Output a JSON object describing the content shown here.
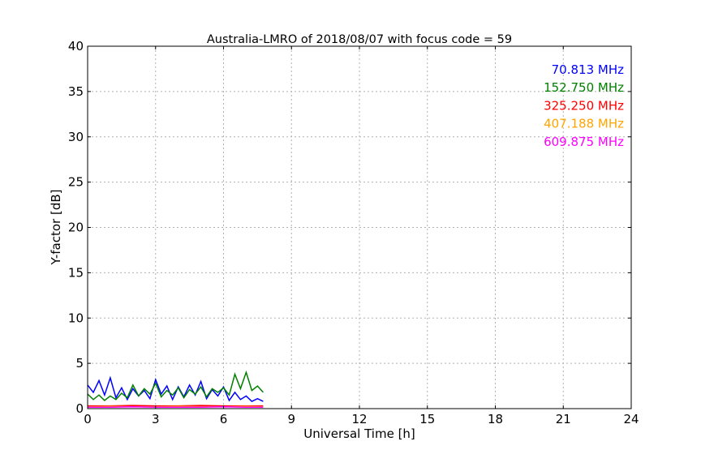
{
  "chart_data": {
    "type": "line",
    "title": "Australia-LMRO of 2018/08/07 with focus code = 59",
    "xlabel": "Universal Time [h]",
    "ylabel": "Y-factor [dB]",
    "xlim": [
      0,
      24
    ],
    "ylim": [
      0,
      40
    ],
    "xticks": [
      0,
      3,
      6,
      9,
      12,
      15,
      18,
      21,
      24
    ],
    "yticks": [
      0,
      5,
      10,
      15,
      20,
      25,
      30,
      35,
      40
    ],
    "grid": true,
    "legend_placement": "top-right",
    "series": [
      {
        "name": "70.813 MHz",
        "color": "#0000ff",
        "x": [
          0,
          0.25,
          0.5,
          0.75,
          1,
          1.25,
          1.5,
          1.75,
          2,
          2.25,
          2.5,
          2.75,
          3,
          3.25,
          3.5,
          3.75,
          4,
          4.25,
          4.5,
          4.75,
          5,
          5.25,
          5.5,
          5.75,
          6,
          6.25,
          6.5,
          6.75,
          7,
          7.25,
          7.5,
          7.75
        ],
        "values": [
          2.6,
          1.8,
          3.1,
          1.5,
          3.4,
          1.2,
          2.3,
          1.0,
          2.2,
          1.4,
          2.0,
          1.1,
          3.2,
          1.6,
          2.5,
          1.0,
          2.4,
          1.3,
          2.6,
          1.5,
          3.0,
          1.1,
          2.1,
          1.4,
          2.4,
          0.9,
          1.8,
          1.0,
          1.4,
          0.8,
          1.1,
          0.8
        ]
      },
      {
        "name": "152.750 MHz",
        "color": "#008000",
        "x": [
          0,
          0.25,
          0.5,
          0.75,
          1,
          1.25,
          1.5,
          1.75,
          2,
          2.25,
          2.5,
          2.75,
          3,
          3.25,
          3.5,
          3.75,
          4,
          4.25,
          4.5,
          4.75,
          5,
          5.25,
          5.5,
          5.75,
          6,
          6.25,
          6.5,
          6.75,
          7,
          7.25,
          7.5,
          7.75
        ],
        "values": [
          1.6,
          1.0,
          1.5,
          0.9,
          1.4,
          1.0,
          1.7,
          1.2,
          2.6,
          1.4,
          2.2,
          1.6,
          2.8,
          1.3,
          2.0,
          1.5,
          2.3,
          1.2,
          2.1,
          1.6,
          2.4,
          1.3,
          2.2,
          1.8,
          2.3,
          1.5,
          3.8,
          2.2,
          4.0,
          2.0,
          2.5,
          1.8
        ]
      },
      {
        "name": "325.250 MHz",
        "color": "#ff0000",
        "x": [
          0,
          1,
          2,
          3,
          4,
          5,
          6,
          7,
          7.75
        ],
        "values": [
          0.3,
          0.3,
          0.35,
          0.3,
          0.3,
          0.35,
          0.3,
          0.3,
          0.3
        ]
      },
      {
        "name": "407.188 MHz",
        "color": "#ffa500",
        "x": [
          0,
          1,
          2,
          3,
          4,
          5,
          6,
          7,
          7.75
        ],
        "values": [
          0.2,
          0.25,
          0.2,
          0.2,
          0.25,
          0.2,
          0.2,
          0.25,
          0.2
        ]
      },
      {
        "name": "609.875 MHz",
        "color": "#ff00ff",
        "x": [
          0,
          1,
          2,
          3,
          4,
          5,
          6,
          7,
          7.75
        ],
        "values": [
          0.15,
          0.15,
          0.2,
          0.15,
          0.15,
          0.15,
          0.2,
          0.15,
          0.15
        ]
      }
    ]
  }
}
